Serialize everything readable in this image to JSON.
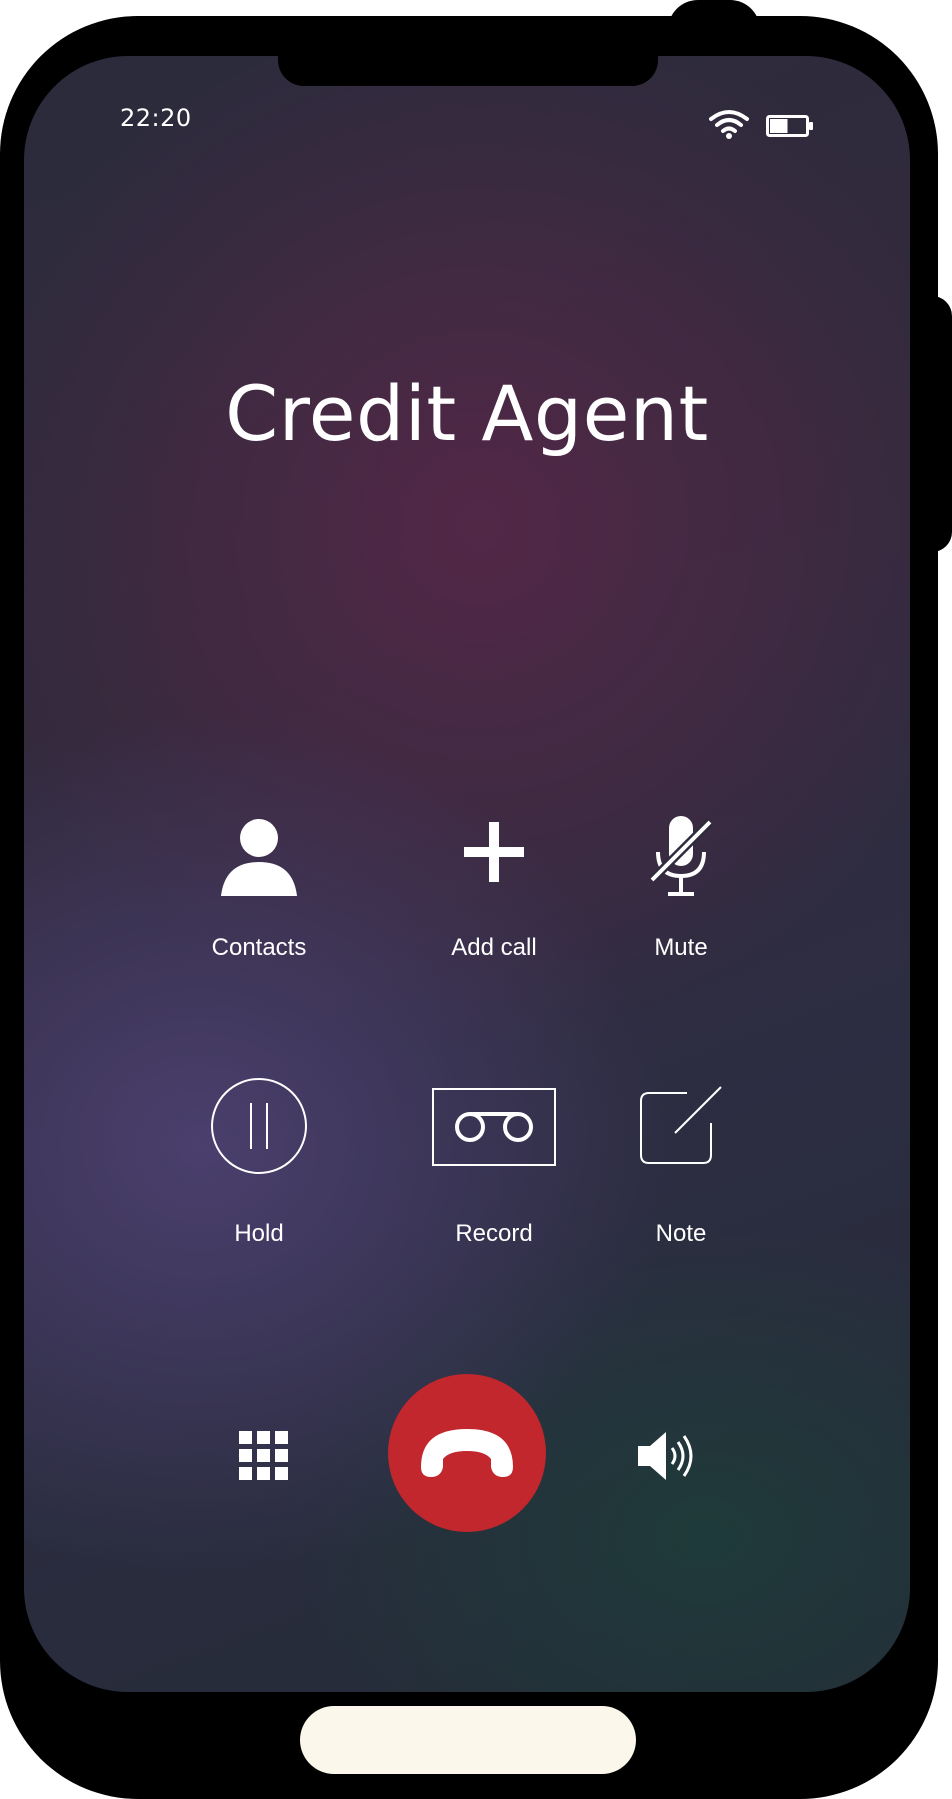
{
  "status_bar": {
    "time": "22:20",
    "wifi_icon": "wifi-icon",
    "battery_icon": "battery-icon",
    "battery_level": 0.5
  },
  "call": {
    "contact_name": "Credit Agent"
  },
  "actions": [
    {
      "label": "Contacts",
      "icon": "person-icon"
    },
    {
      "label": "Add call",
      "icon": "plus-icon"
    },
    {
      "label": "Mute",
      "icon": "microphone-muted-icon"
    },
    {
      "label": "Hold",
      "icon": "pause-icon"
    },
    {
      "label": "Record",
      "icon": "tape-icon"
    },
    {
      "label": "Note",
      "icon": "edit-note-icon"
    }
  ],
  "bottom_controls": {
    "keypad_icon": "keypad-icon",
    "end_call_icon": "phone-hangup-icon",
    "speaker_icon": "speaker-icon"
  },
  "colors": {
    "end_call": "#c1272d",
    "text": "#ffffff",
    "home_indicator": "#fbf7ea"
  }
}
